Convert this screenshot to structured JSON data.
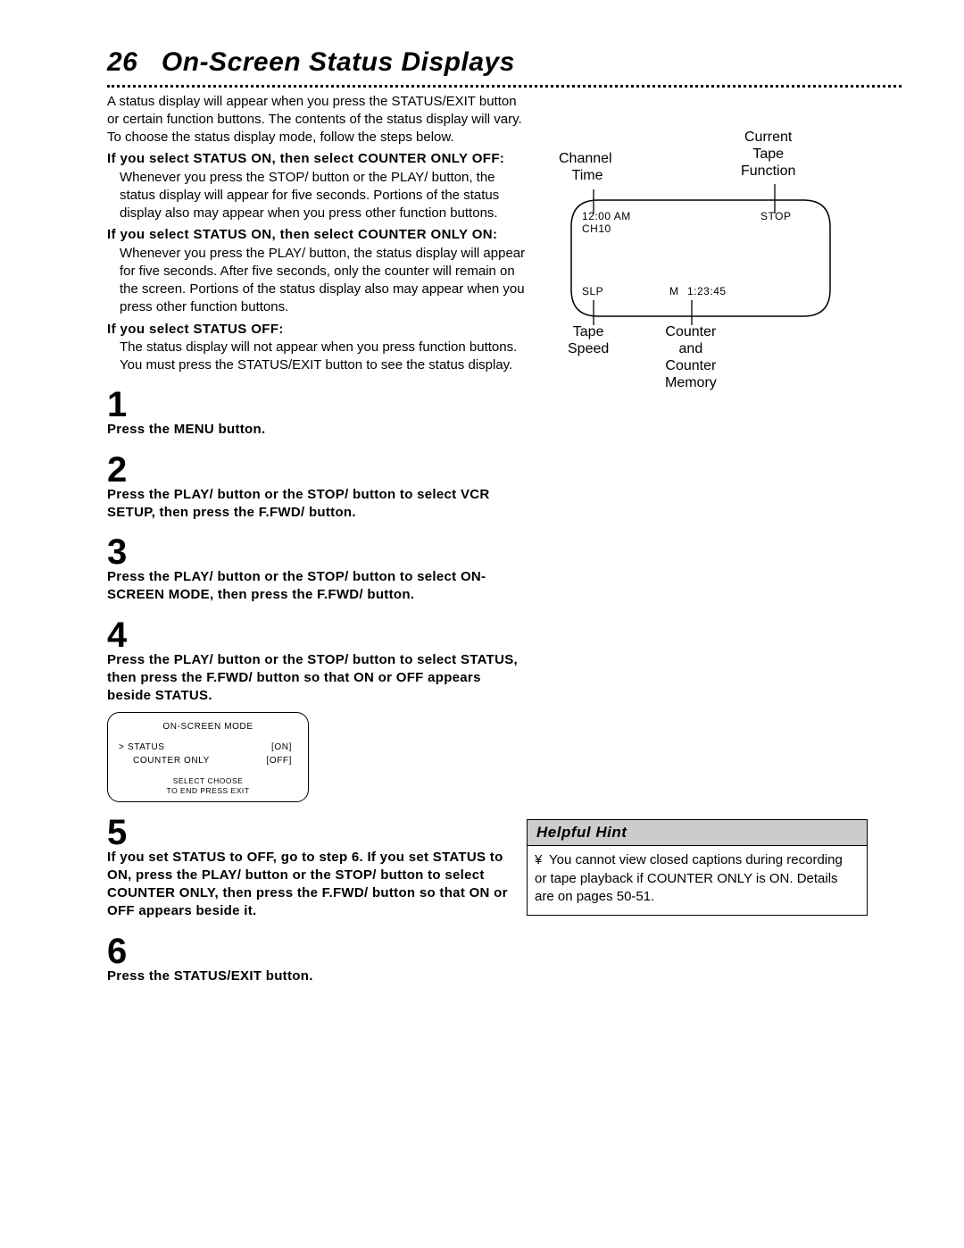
{
  "page_number": "26",
  "page_title": "On-Screen Status Displays",
  "intro": "A status display will appear when you press the STATUS/EXIT button or certain function buttons. The contents of the status display will vary. To choose the status display mode, follow the steps below.",
  "sections": {
    "s1_heading": "If you select STATUS ON, then select COUNTER ONLY OFF:",
    "s1_body": "Whenever you press the STOP/    button or the PLAY/    button, the status display will appear for five seconds. Portions of the status display also may appear when you press other function buttons.",
    "s2_heading": "If you select STATUS ON, then select COUNTER ONLY ON:",
    "s2_body": "Whenever you press the PLAY/    button, the status display will appear for five seconds. After five seconds, only the counter will remain on the screen. Portions of the status display also may appear when you press other function buttons.",
    "s3_heading": "If you select STATUS OFF:",
    "s3_body": "The status display will not appear when you press function buttons. You must press the STATUS/EXIT button to see the status display."
  },
  "steps": {
    "n1": "1",
    "t1": "Press the MENU button.",
    "n2": "2",
    "t2": "Press the PLAY/    button or the STOP/    button to select VCR SETUP, then press the F.FWD/    button.",
    "n3": "3",
    "t3": "Press the PLAY/    button or the STOP/    button to select ON-SCREEN MODE, then press the F.FWD/    button.",
    "n4": "4",
    "t4": "Press the PLAY/    button or the STOP/    button to select STATUS, then press the F.FWD/    button so that ON or OFF appears beside STATUS.",
    "n5": "5",
    "t5": "If you set STATUS to OFF, go to step 6. If you set STATUS to ON, press the PLAY/    button or the STOP/    button to select COUNTER ONLY, then press the F.FWD/    button so that ON or OFF appears beside it.",
    "n6": "6",
    "t6": "Press the STATUS/EXIT button"
  },
  "tv": {
    "label_channel": "Channel\nTime",
    "label_function": "Current\nTape\nFunction",
    "label_speed": "Tape\nSpeed",
    "label_counter": "Counter\nand\nCounter\nMemory",
    "time": "12:00 AM",
    "channel": "CH10",
    "func": "STOP",
    "speed": "SLP",
    "mem": "M",
    "counter": "1:23:45"
  },
  "osd": {
    "title": "ON-SCREEN MODE",
    "row1_label": "STATUS",
    "row1_val": "[ON]",
    "row2_label": "COUNTER ONLY",
    "row2_val": "[OFF]",
    "footer1": "SELECT      CHOOSE",
    "footer2": "TO  END  PRESS  EXIT"
  },
  "hint": {
    "title": "Helpful Hint",
    "bullet_char": "¥",
    "body": "You cannot view closed captions during recording or tape playback if COUNTER ONLY is ON. Details are on pages 50-51."
  }
}
